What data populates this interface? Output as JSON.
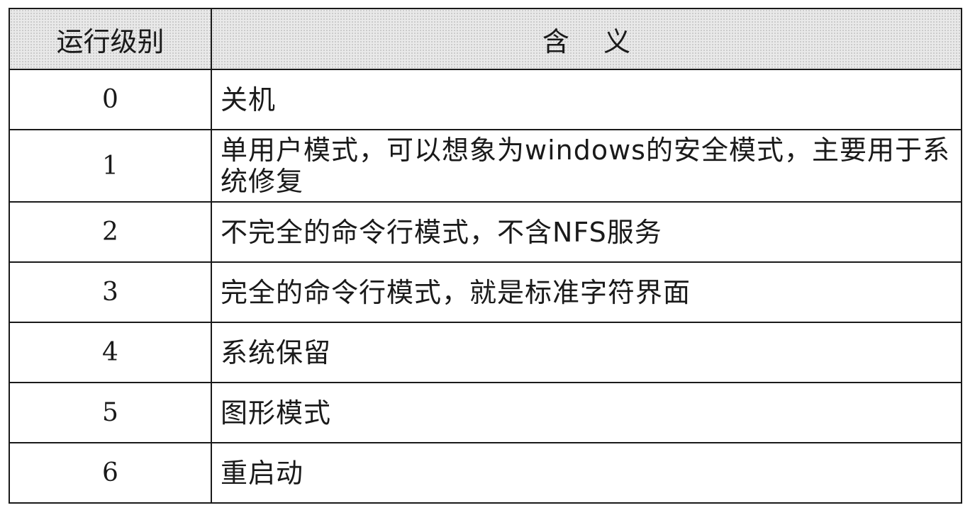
{
  "table": {
    "headers": {
      "level": "运行级别",
      "meaning": "含    义"
    },
    "rows": [
      {
        "level": "0",
        "meaning": "关机"
      },
      {
        "level": "1",
        "meaning": "单用户模式，可以想象为windows的安全模式，主要用于系统修复"
      },
      {
        "level": "2",
        "meaning": "不完全的命令行模式，不含NFS服务"
      },
      {
        "level": "3",
        "meaning": "完全的命令行模式，就是标准字符界面"
      },
      {
        "level": "4",
        "meaning": "系统保留"
      },
      {
        "level": "5",
        "meaning": "图形模式"
      },
      {
        "level": "6",
        "meaning": "重启动"
      }
    ]
  }
}
